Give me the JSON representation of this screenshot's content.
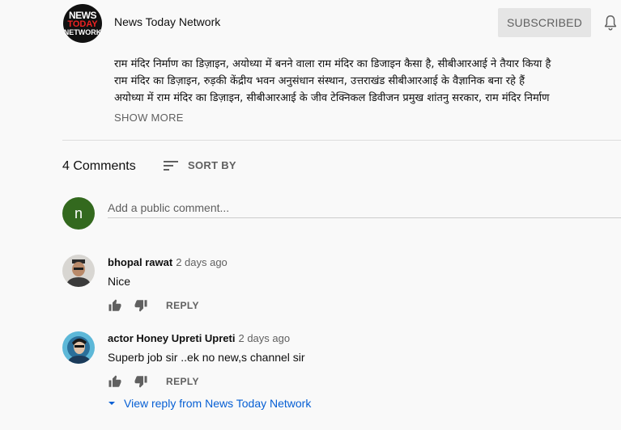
{
  "channel": {
    "name": "News Today Network",
    "avatar_lines": [
      "NEWS",
      "TODAY",
      "NETWORK"
    ],
    "subscribe_label": "SUBSCRIBED"
  },
  "description": {
    "lines": [
      "राम मंदिर निर्माण का डिज़ाइन, अयोध्या में बनने वाला राम मंदिर का डिजाइन कैसा है, सीबीआरआई ने तैयार किया है",
      "राम मंदिर का डिज़ाइन, रुड़की केंद्रीय भवन अनुसंधान संस्थान, उत्तराखंड सीबीआरआई के वैज्ञानिक बना रहे हैं",
      "अयोध्या में राम मंदिर का डिज़ाइन, सीबीआरआई के जीव टेक्निकल डिवीजन प्रमुख शांतनु सरकार, राम मंदिर निर्माण"
    ],
    "show_more": "SHOW MORE"
  },
  "comments_header": {
    "count": "4 Comments",
    "sort_label": "SORT BY"
  },
  "add_comment": {
    "avatar_letter": "n",
    "placeholder": "Add a public comment..."
  },
  "comments": [
    {
      "author": "bhopal rawat",
      "time": "2 days ago",
      "text": "Nice",
      "reply_label": "REPLY"
    },
    {
      "author": "actor Honey Upreti Upreti",
      "time": "2 days ago",
      "text": "Superb job sir ..ek no new,s channel sir",
      "reply_label": "REPLY",
      "view_reply": "View reply from News Today Network"
    }
  ],
  "colors": {
    "background": "#f9f9f9",
    "link": "#065fd4",
    "avatar_green": "#33691e",
    "subscribed_bg": "#e5e5e5"
  }
}
